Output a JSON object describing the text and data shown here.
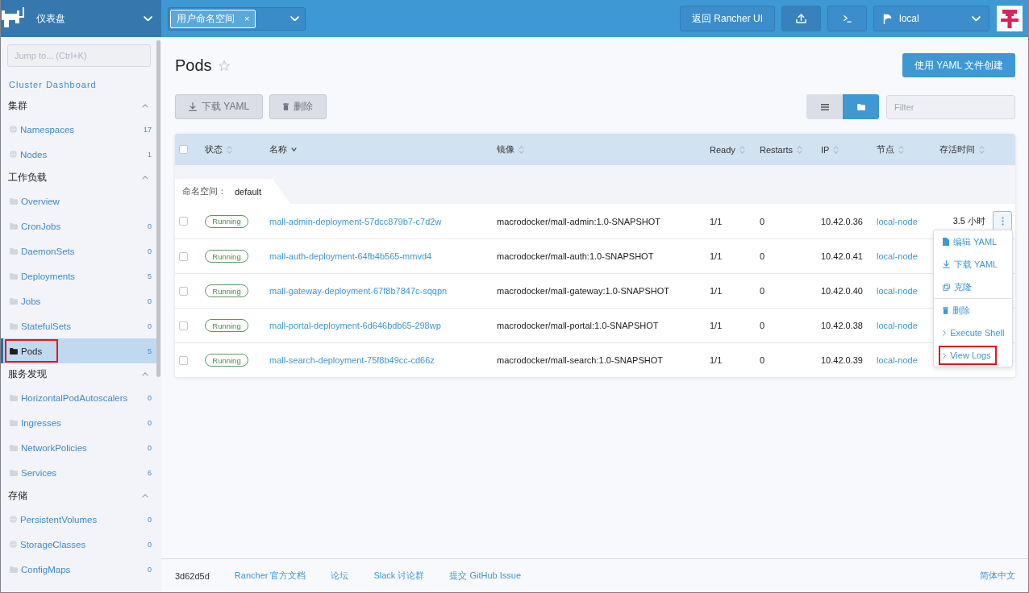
{
  "top_bar": {
    "product_menu": {
      "label": "仪表盘"
    },
    "namespace_filter": {
      "chips": [
        {
          "label": "用户命名空间",
          "remove": "×"
        }
      ]
    },
    "back_button": "返回 Rancher UI",
    "cluster_select": {
      "value": "local"
    }
  },
  "sidebar": {
    "search": {
      "placeholder": "Jump to... (Ctrl+K)"
    },
    "dashboard_link": "Cluster Dashboard",
    "groups": [
      {
        "title": "集群",
        "expanded": true,
        "items": [
          {
            "label": "Namespaces",
            "count": "17",
            "kind": "cluster",
            "selected": false,
            "highlighted": false
          },
          {
            "label": "Nodes",
            "count": "1",
            "kind": "cluster",
            "selected": false,
            "highlighted": false
          }
        ]
      },
      {
        "title": "工作负载",
        "expanded": true,
        "items": [
          {
            "label": "Overview",
            "kind": "namespaced",
            "selected": false,
            "highlighted": false
          },
          {
            "label": "CronJobs",
            "count": "0",
            "kind": "namespaced",
            "selected": false,
            "highlighted": false
          },
          {
            "label": "DaemonSets",
            "count": "0",
            "kind": "namespaced",
            "selected": false,
            "highlighted": false
          },
          {
            "label": "Deployments",
            "count": "5",
            "kind": "namespaced",
            "selected": false,
            "highlighted": false
          },
          {
            "label": "Jobs",
            "count": "0",
            "kind": "namespaced",
            "selected": false,
            "highlighted": false
          },
          {
            "label": "StatefulSets",
            "count": "0",
            "kind": "namespaced",
            "selected": false,
            "highlighted": false
          },
          {
            "label": "Pods",
            "count": "5",
            "kind": "namespaced",
            "selected": true,
            "highlighted": true
          }
        ]
      },
      {
        "title": "服务发现",
        "expanded": true,
        "items": [
          {
            "label": "HorizontalPodAutoscalers",
            "count": "0",
            "kind": "namespaced",
            "selected": false,
            "highlighted": false
          },
          {
            "label": "Ingresses",
            "count": "0",
            "kind": "namespaced",
            "selected": false,
            "highlighted": false
          },
          {
            "label": "NetworkPolicies",
            "count": "0",
            "kind": "namespaced",
            "selected": false,
            "highlighted": false
          },
          {
            "label": "Services",
            "count": "6",
            "kind": "namespaced",
            "selected": false,
            "highlighted": false
          }
        ]
      },
      {
        "title": "存储",
        "expanded": true,
        "items": [
          {
            "label": "PersistentVolumes",
            "count": "0",
            "kind": "cluster",
            "selected": false,
            "highlighted": false
          },
          {
            "label": "StorageClasses",
            "count": "0",
            "kind": "cluster",
            "selected": false,
            "highlighted": false
          },
          {
            "label": "ConfigMaps",
            "count": "0",
            "kind": "namespaced",
            "selected": false,
            "highlighted": false
          }
        ]
      }
    ]
  },
  "page": {
    "title": "Pods",
    "favorite": false,
    "create_button": "使用 YAML 文件创建",
    "download_button": {
      "label": "下载 YAML",
      "disabled": true
    },
    "delete_button": {
      "label": "删除",
      "disabled": true
    },
    "view_toggle": [
      {
        "kind": "list",
        "selected": false
      },
      {
        "kind": "group",
        "selected": true
      }
    ],
    "filter": {
      "placeholder": "Filter"
    }
  },
  "table": {
    "select_all": {
      "checked": false
    },
    "columns": [
      {
        "label": "状态",
        "sorted": false
      },
      {
        "label": "名称",
        "sorted": true
      },
      {
        "label": "镜像",
        "sorted": false
      },
      {
        "label": "Ready",
        "sorted": false
      },
      {
        "label": "Restarts",
        "sorted": false
      },
      {
        "label": "IP",
        "sorted": false
      },
      {
        "label": "节点",
        "sorted": false
      },
      {
        "label": "存活时间",
        "sorted": false
      }
    ],
    "group": {
      "label": "命名空间：",
      "value": "default"
    },
    "rows": [
      {
        "checked": false,
        "state": "Running",
        "name": "mall-admin-deployment-57dcc879b7-c7d2w",
        "image": "macrodocker/mall-admin:1.0-SNAPSHOT",
        "ready": "1/1",
        "restarts": "0",
        "ip": "10.42.0.36",
        "node": "local-node",
        "age": "3.5 小时",
        "menu_open": true
      },
      {
        "checked": false,
        "state": "Running",
        "name": "mall-auth-deployment-64fb4b565-mmvd4",
        "image": "macrodocker/mall-auth:1.0-SNAPSHOT",
        "ready": "1/1",
        "restarts": "0",
        "ip": "10.42.0.41",
        "node": "local-node",
        "menu_open": false
      },
      {
        "checked": false,
        "state": "Running",
        "name": "mall-gateway-deployment-67f8b7847c-sqqpn",
        "image": "macrodocker/mall-gateway:1.0-SNAPSHOT",
        "ready": "1/1",
        "restarts": "0",
        "ip": "10.42.0.40",
        "node": "local-node",
        "menu_open": false
      },
      {
        "checked": false,
        "state": "Running",
        "name": "mall-portal-deployment-6d646bdb65-298wp",
        "image": "macrodocker/mall-portal:1.0-SNAPSHOT",
        "ready": "1/1",
        "restarts": "0",
        "ip": "10.42.0.38",
        "node": "local-node",
        "menu_open": false
      },
      {
        "checked": false,
        "state": "Running",
        "name": "mall-search-deployment-75f8b49cc-cd66z",
        "image": "macrodocker/mall-search:1.0-SNAPSHOT",
        "ready": "1/1",
        "restarts": "0",
        "ip": "10.42.0.39",
        "node": "local-node",
        "menu_open": false
      }
    ],
    "row_menu": {
      "sections": [
        [
          {
            "label": "编辑 YAML",
            "kind": "edit",
            "highlighted": false
          },
          {
            "label": "下载 YAML",
            "kind": "download",
            "highlighted": false
          },
          {
            "label": "克隆",
            "kind": "clone",
            "highlighted": false
          }
        ],
        [
          {
            "label": "删除",
            "kind": "delete",
            "highlighted": false
          },
          {
            "label": "Execute Shell",
            "kind": "shell",
            "highlighted": false
          },
          {
            "label": "View Logs",
            "kind": "logs",
            "highlighted": true
          }
        ]
      ]
    }
  },
  "footer": {
    "version": "3d62d5d",
    "links": [
      "Rancher 官方文档",
      "论坛",
      "Slack 讨论群",
      "提交 GitHub Issue"
    ],
    "language": "简体中文"
  }
}
